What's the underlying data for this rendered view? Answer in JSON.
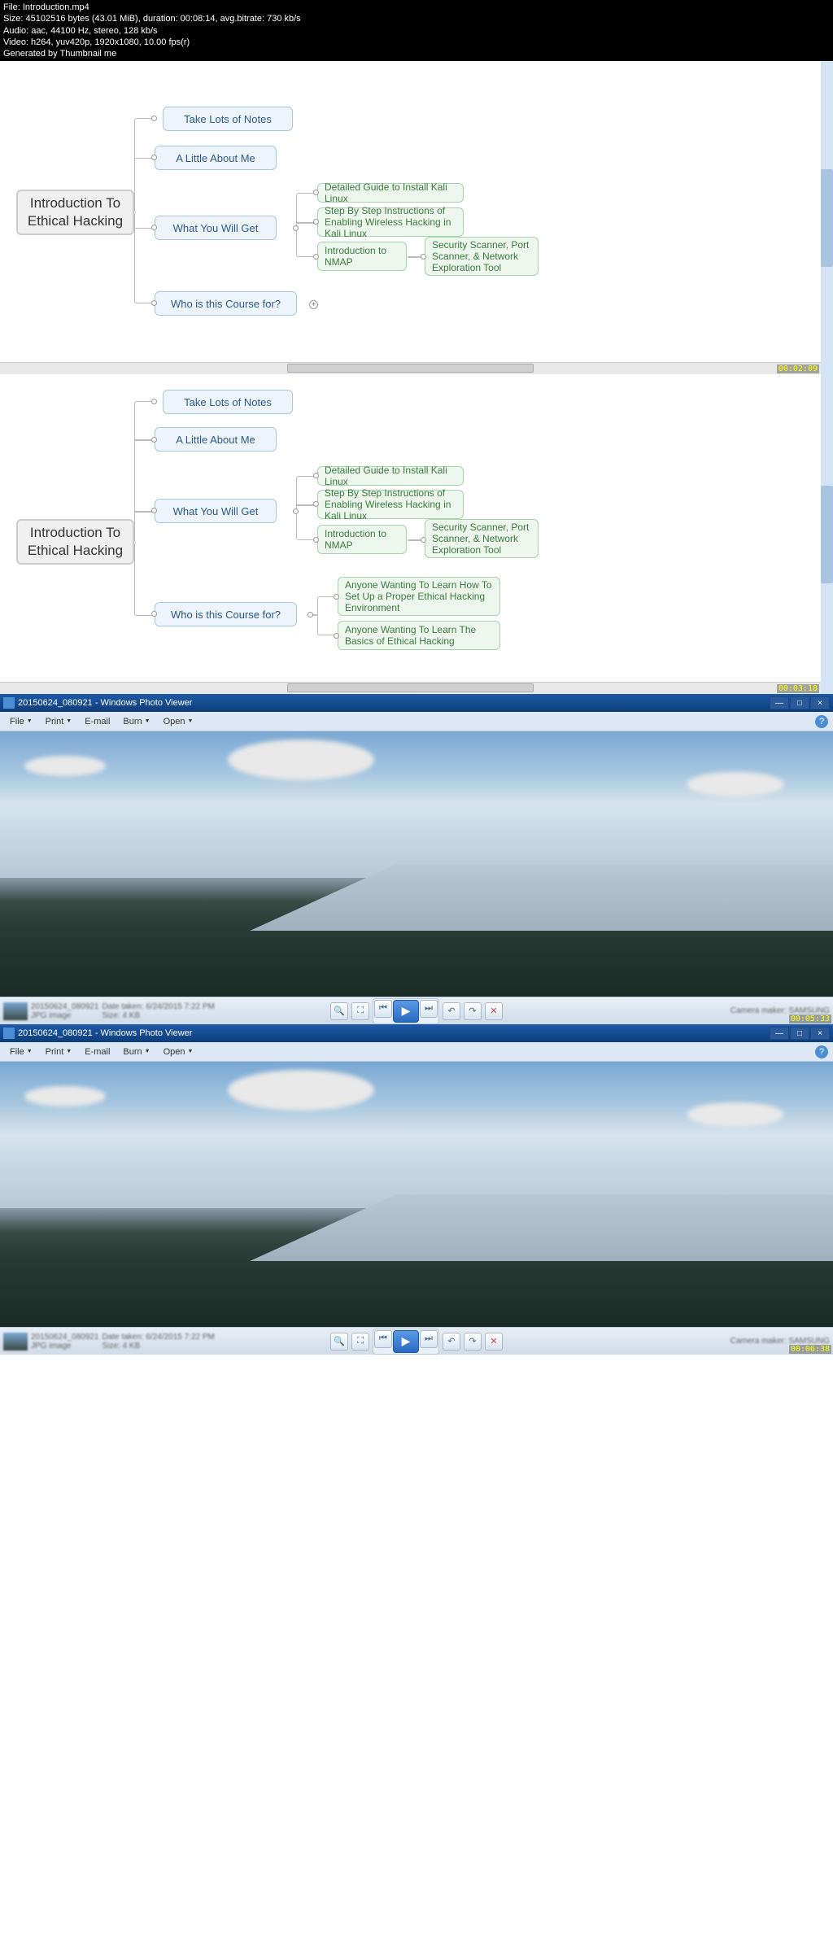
{
  "header": {
    "file": "File: Introduction.mp4",
    "size": "Size: 45102516 bytes (43.01 MiB), duration: 00:08:14, avg.bitrate: 730 kb/s",
    "audio": "Audio: aac, 44100 Hz, stereo, 128 kb/s",
    "video": "Video: h264, yuv420p, 1920x1080, 10.00 fps(r)",
    "generated": "Generated by Thumbnail me"
  },
  "mindmap": {
    "root": "Introduction To Ethical Hacking",
    "notes": "Take Lots of Notes",
    "about": "A Little About Me",
    "what": "What You Will Get",
    "who": "Who is this Course for?",
    "kali": "Detailed Guide to Install Kali Linux",
    "wireless": "Step By Step Instructions of Enabling Wireless Hacking in Kali Linux",
    "nmap": "Introduction to NMAP",
    "scanner": "Security Scanner, Port Scanner, & Network Exploration Tool",
    "anyone1": "Anyone Wanting To Learn How To Set Up a Proper Ethical Hacking Environment",
    "anyone2": "Anyone Wanting To Learn The Basics of Ethical Hacking",
    "ts1": "00:02:09",
    "ts2": "00:03:18",
    "ts3": "00:05:33",
    "ts4": "00:06:38"
  },
  "photo": {
    "title": "20150624_080921 - Windows Photo Viewer",
    "file": "File",
    "print": "Print",
    "email": "E-mail",
    "burn": "Burn",
    "open": "Open",
    "help": "?",
    "min": "—",
    "max": "□",
    "close": "×",
    "info1": "20150624_080921",
    "info2": "Date taken: 6/24/2015 7:22 PM",
    "info3": "JPG image",
    "info4": "Size: 4 KB",
    "camera": "Camera maker: SAMSUNG"
  }
}
